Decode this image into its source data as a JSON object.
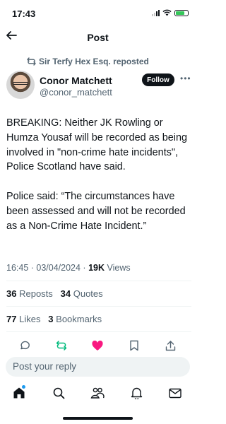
{
  "status_bar": {
    "time": "17:43"
  },
  "header": {
    "title": "Post"
  },
  "repost": {
    "text": "Sir Terfy Hex Esq. reposted"
  },
  "author": {
    "name": "Conor Matchett",
    "handle": "@conor_matchett",
    "follow_label": "Follow"
  },
  "tweet": {
    "paragraph1": "BREAKING: Neither JK Rowling or Humza Yousaf will be recorded as being involved in \"non-crime hate incidents\", Police Scotland have said.",
    "paragraph2": "Police said: “The circumstances have been assessed and will not be recorded as a Non-Crime Hate Incident.”",
    "time": "16:45",
    "date": "03/04/2024",
    "views_count": "19K",
    "views_label": "Views"
  },
  "stats": {
    "reposts_count": "36",
    "reposts_label": "Reposts",
    "quotes_count": "34",
    "quotes_label": "Quotes",
    "likes_count": "77",
    "likes_label": "Likes",
    "bookmarks_count": "3",
    "bookmarks_label": "Bookmarks"
  },
  "actions": {
    "icons": [
      "reply-icon",
      "repost-icon",
      "like-icon",
      "bookmark-icon",
      "share-icon"
    ],
    "repost_color": "#00ba7c",
    "like_color": "#f91880"
  },
  "reply": {
    "placeholder": "Post your reply"
  },
  "tabbar": {
    "icons": [
      "home-icon",
      "search-icon",
      "communities-icon",
      "notifications-icon",
      "messages-icon"
    ],
    "badge_color": "#1d9bf0"
  }
}
